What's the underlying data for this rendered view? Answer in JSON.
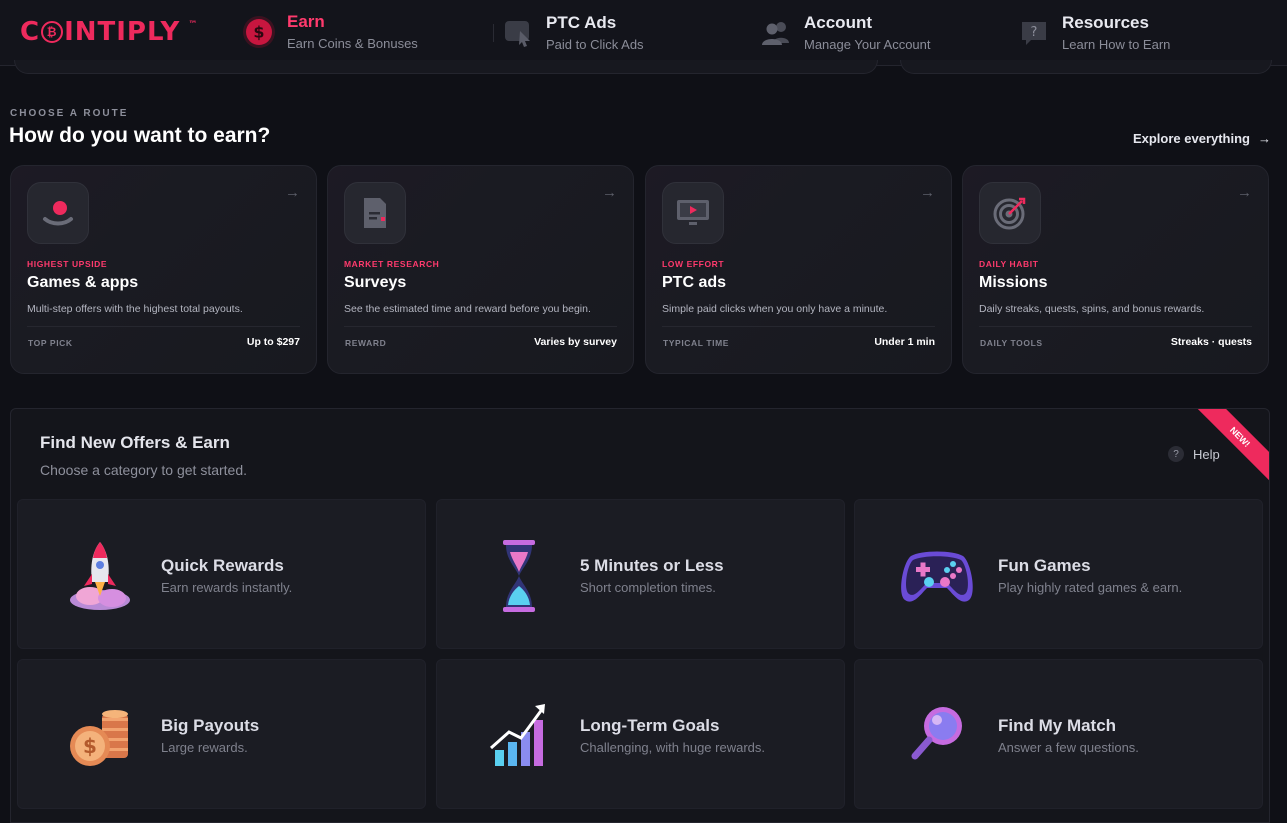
{
  "brand": {
    "name_pre": "C",
    "name_post": "INTIPLY",
    "tm": "™"
  },
  "nav": [
    {
      "title": "Earn",
      "subtitle": "Earn Coins & Bonuses",
      "icon": "dollar-icon",
      "active": true
    },
    {
      "title": "PTC Ads",
      "subtitle": "Paid to Click Ads",
      "icon": "click-ads-icon",
      "active": false
    },
    {
      "title": "Account",
      "subtitle": "Manage Your Account",
      "icon": "users-icon",
      "active": false
    },
    {
      "title": "Resources",
      "subtitle": "Learn How to Earn",
      "icon": "help-bubble-icon",
      "active": false
    }
  ],
  "routes": {
    "eyebrow": "CHOOSE A ROUTE",
    "title": "How do you want to earn?",
    "explore_label": "Explore everything",
    "explore_arrow": "→",
    "cards": [
      {
        "tag": "HIGHEST UPSIDE",
        "title": "Games & apps",
        "desc": "Multi-step offers with the highest total payouts.",
        "label": "TOP PICK",
        "value": "Up to $297",
        "icon": "games-apps-icon",
        "arrow": "→"
      },
      {
        "tag": "MARKET RESEARCH",
        "title": "Surveys",
        "desc": "See the estimated time and reward before you begin.",
        "label": "REWARD",
        "value": "Varies by survey",
        "icon": "survey-doc-icon",
        "arrow": "→"
      },
      {
        "tag": "LOW EFFORT",
        "title": "PTC ads",
        "desc": "Simple paid clicks when you only have a minute.",
        "label": "TYPICAL TIME",
        "value": "Under 1 min",
        "icon": "monitor-play-icon",
        "arrow": "→"
      },
      {
        "tag": "DAILY HABIT",
        "title": "Missions",
        "desc": "Daily streaks, quests, spins, and bonus rewards.",
        "label": "DAILY TOOLS",
        "value": "Streaks · quests",
        "icon": "target-icon",
        "arrow": "→"
      }
    ]
  },
  "offers": {
    "title": "Find New Offers & Earn",
    "subtitle": "Choose a category to get started.",
    "help_label": "Help",
    "help_glyph": "?",
    "ribbon": "NEW!",
    "tiles": [
      {
        "title": "Quick Rewards",
        "subtitle": "Earn rewards instantly.",
        "icon": "rocket-icon"
      },
      {
        "title": "5 Minutes or Less",
        "subtitle": "Short completion times.",
        "icon": "hourglass-icon"
      },
      {
        "title": "Fun Games",
        "subtitle": "Play highly rated games & earn.",
        "icon": "gamepad-icon"
      },
      {
        "title": "Big Payouts",
        "subtitle": "Large rewards.",
        "icon": "coin-stack-icon"
      },
      {
        "title": "Long-Term Goals",
        "subtitle": "Challenging, with huge rewards.",
        "icon": "growth-chart-icon"
      },
      {
        "title": "Find My Match",
        "subtitle": "Answer a few questions.",
        "icon": "magnifier-icon"
      }
    ]
  },
  "colors": {
    "accent": "#ee2a5d",
    "bg": "#0f1016",
    "card": "#1b1c23"
  }
}
